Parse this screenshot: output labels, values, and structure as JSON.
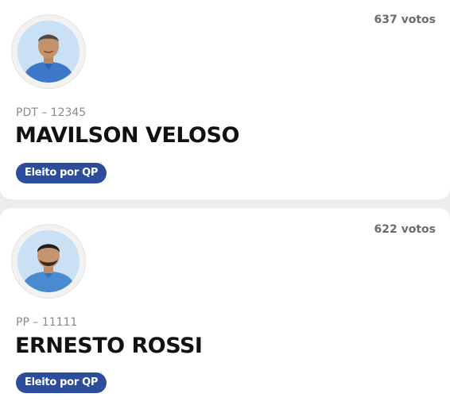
{
  "candidates": [
    {
      "votes": "637 votos",
      "party": "PDT – 12345",
      "name": "MAVILSON VELOSO",
      "badge": "Eleito por QP",
      "avatar_icon": "person-photo"
    },
    {
      "votes": "622 votos",
      "party": "PP – 11111",
      "name": "ERNESTO ROSSI",
      "badge": "Eleito por QP",
      "avatar_icon": "person-photo"
    }
  ]
}
